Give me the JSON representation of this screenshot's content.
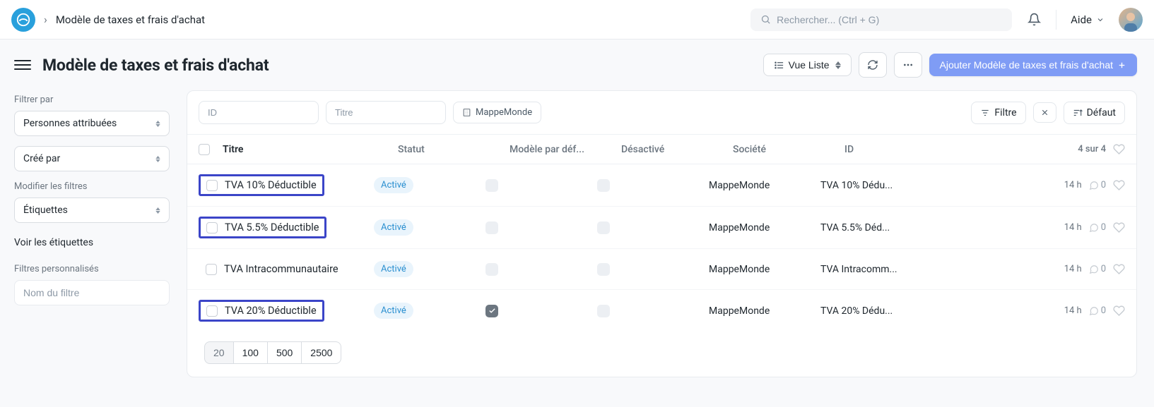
{
  "nav": {
    "breadcrumb": "Modèle de taxes et frais d'achat",
    "search_placeholder": "Rechercher... (Ctrl + G)",
    "help_label": "Aide"
  },
  "header": {
    "title": "Modèle de taxes et frais d'achat",
    "view_label": "Vue Liste",
    "add_label": "Ajouter Modèle de taxes et frais d'achat"
  },
  "sidebar": {
    "filter_by": "Filtrer par",
    "assigned": "Personnes attribuées",
    "created_by": "Créé par",
    "modify_filters": "Modifier les filtres",
    "tags": "Étiquettes",
    "view_tags": "Voir les étiquettes",
    "custom_filters": "Filtres personnalisés",
    "filter_name_placeholder": "Nom du filtre"
  },
  "filter_bar": {
    "id_placeholder": "ID",
    "title_placeholder": "Titre",
    "company_chip": "MappeMonde",
    "filter_btn": "Filtre",
    "sort_btn": "Défaut"
  },
  "table": {
    "cols": {
      "title": "Titre",
      "status": "Statut",
      "default": "Modèle par déf...",
      "disabled": "Désactivé",
      "company": "Société",
      "id": "ID"
    },
    "count": "4 sur 4",
    "rows": [
      {
        "title": "TVA 10% Déductible",
        "status": "Activé",
        "is_default": false,
        "company": "MappeMonde",
        "id": "TVA 10% Dédu...",
        "age": "14 h",
        "comments": 0,
        "highlight": true
      },
      {
        "title": "TVA 5.5% Déductible",
        "status": "Activé",
        "is_default": false,
        "company": "MappeMonde",
        "id": "TVA 5.5% Déd...",
        "age": "14 h",
        "comments": 0,
        "highlight": true
      },
      {
        "title": "TVA Intracommunautaire",
        "status": "Activé",
        "is_default": false,
        "company": "MappeMonde",
        "id": "TVA Intracomm...",
        "age": "14 h",
        "comments": 0,
        "highlight": false
      },
      {
        "title": "TVA 20% Déductible",
        "status": "Activé",
        "is_default": true,
        "company": "MappeMonde",
        "id": "TVA 20% Dédu...",
        "age": "14 h",
        "comments": 0,
        "highlight": true
      }
    ]
  },
  "pagination": {
    "sizes": [
      "20",
      "100",
      "500",
      "2500"
    ],
    "active": "20"
  }
}
